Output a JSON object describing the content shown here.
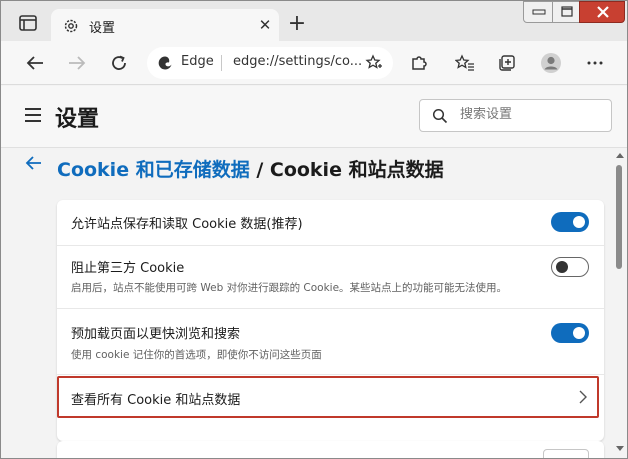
{
  "tab": {
    "title": "设置"
  },
  "address_bar": {
    "brand_label": "Edge",
    "url": "edge://settings/co..."
  },
  "settings": {
    "title": "设置",
    "search_placeholder": "搜索设置"
  },
  "breadcrumb": {
    "parent": "Cookie 和已存储数据",
    "separator": " / ",
    "current": "Cookie 和站点数据"
  },
  "options": [
    {
      "title": "允许站点保存和读取 Cookie 数据(推荐)",
      "description": "",
      "enabled": true
    },
    {
      "title": "阻止第三方 Cookie",
      "description": "启用后，站点不能使用可跨 Web 对你进行跟踪的 Cookie。某些站点上的功能可能无法使用。",
      "enabled": false
    },
    {
      "title": "预加载页面以更快浏览和搜索",
      "description": "使用 cookie 记住你的首选项，即使你不访问这些页面",
      "enabled": true
    }
  ],
  "link_row": {
    "label": "查看所有 Cookie 和站点数据"
  },
  "colors": {
    "accent": "#0f6cbd",
    "highlight_border": "#c0392b",
    "close_button": "#c84031"
  }
}
